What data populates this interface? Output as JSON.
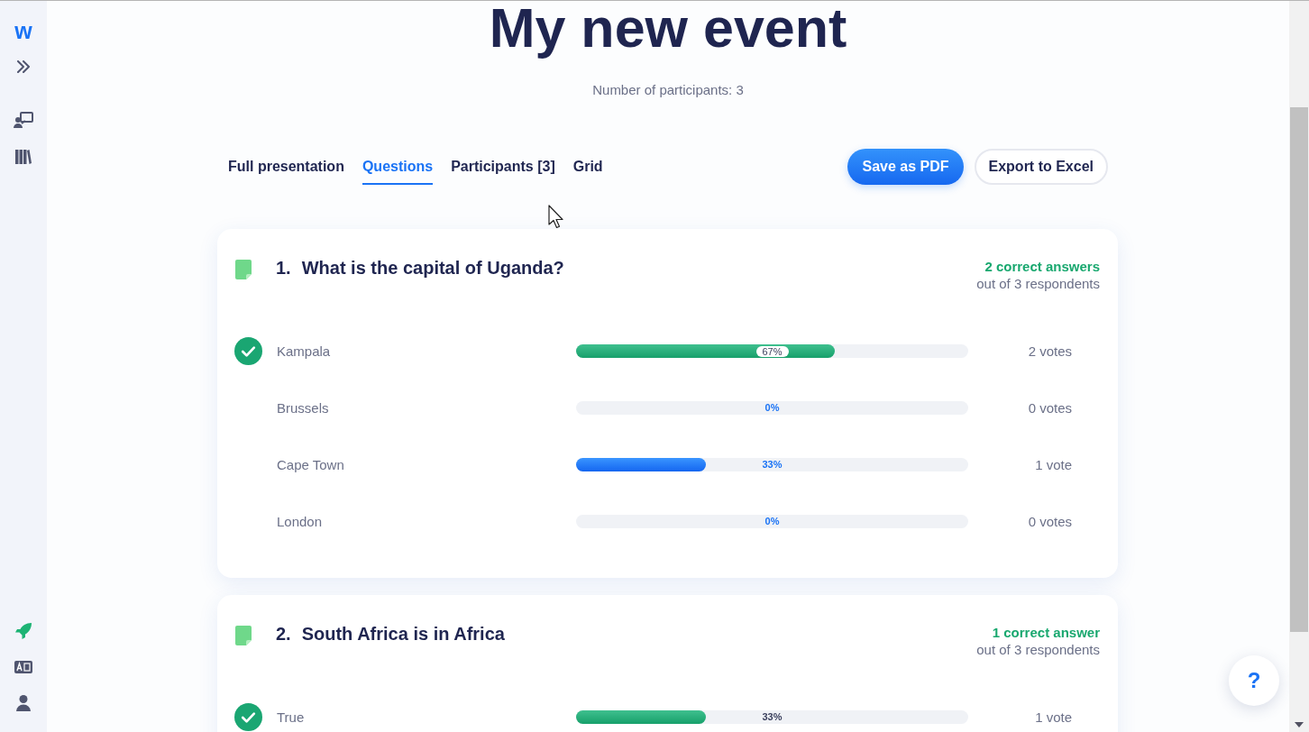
{
  "sidebar": {
    "logo": "w"
  },
  "header": {
    "title": "My new event",
    "participants": "Number of participants: 3"
  },
  "tabs": [
    {
      "label": "Full presentation",
      "selected": false
    },
    {
      "label": "Questions",
      "selected": true
    },
    {
      "label": "Participants [3]",
      "selected": false
    },
    {
      "label": "Grid",
      "selected": false
    }
  ],
  "actions": [
    {
      "label": "Save as PDF",
      "kind": "primary"
    },
    {
      "label": "Export to Excel",
      "kind": "secondary"
    }
  ],
  "questions": [
    {
      "number": "1.",
      "title": "What is the capital of Uganda?",
      "correct_summary": "2 correct answers",
      "respondents": "out of 3 respondents",
      "answers": [
        {
          "label": "Kampala",
          "correct": true,
          "level": 0.66,
          "percent": "67%",
          "votes": "2 votes"
        },
        {
          "label": "Brussels",
          "correct": false,
          "level": 0,
          "percent": "0%",
          "votes": "0 votes"
        },
        {
          "label": "Cape Town",
          "correct": false,
          "level": 0.33,
          "percent": "33%",
          "votes": "1 vote"
        },
        {
          "label": "London",
          "correct": false,
          "level": 0,
          "percent": "0%",
          "votes": "0 votes"
        }
      ]
    },
    {
      "number": "2.",
      "title": "South Africa is in Africa",
      "correct_summary": "1 correct answer",
      "respondents": "out of 3 respondents",
      "answers": [
        {
          "label": "True",
          "correct": true,
          "level": 0.33,
          "percent": "33%",
          "votes": "1 vote"
        }
      ]
    }
  ],
  "help_button": {
    "label": "?"
  }
}
